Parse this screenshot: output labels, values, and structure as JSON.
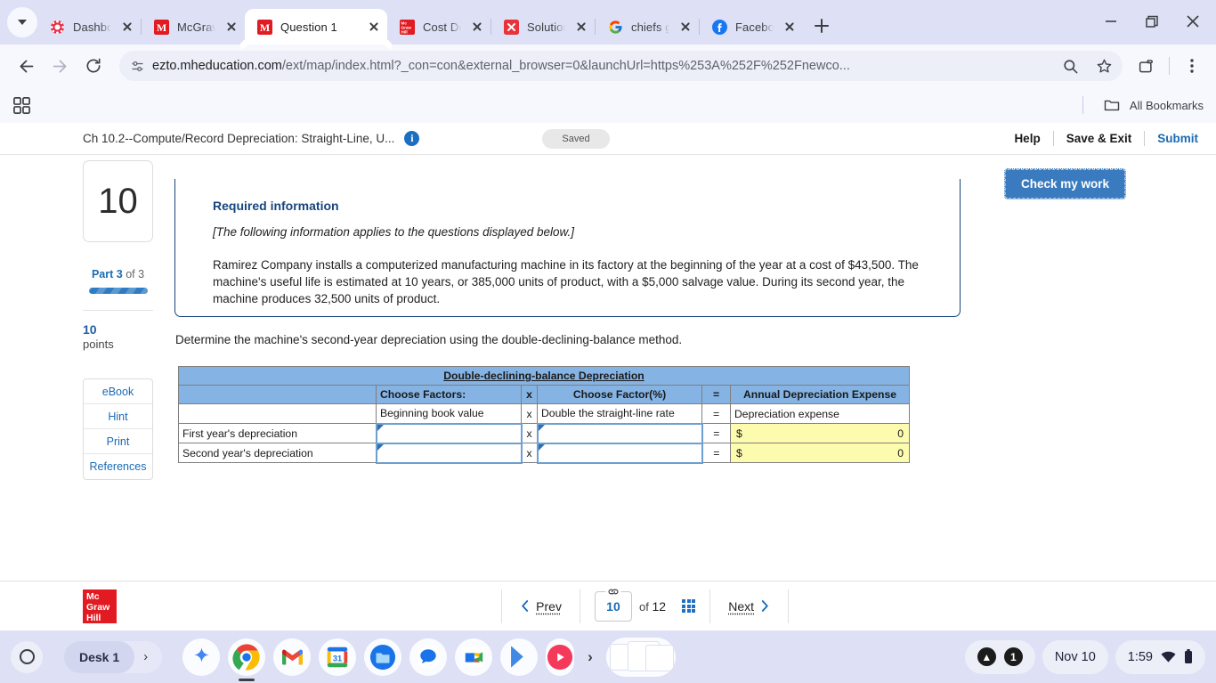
{
  "browser": {
    "tabs": [
      {
        "title": "Dashboard",
        "favicon": "canvas-icon",
        "active": false
      },
      {
        "title": "McGraw H",
        "favicon": "mcgraw-m-icon",
        "active": false
      },
      {
        "title": "Question 1",
        "favicon": "mcgraw-m-icon",
        "active": true
      },
      {
        "title": "Cost Dete",
        "favicon": "mcgraw-hill-icon",
        "active": false
      },
      {
        "title": "Solution -",
        "favicon": "chegg-icon",
        "active": false
      },
      {
        "title": "chiefs gam",
        "favicon": "google-icon",
        "active": false
      },
      {
        "title": "Facebook",
        "favicon": "facebook-icon",
        "active": false
      }
    ],
    "new_tab_label": "+",
    "url_host": "ezto.mheducation.com",
    "url_path": "/ext/map/index.html?_con=con&external_browser=0&launchUrl=https%253A%252F%252Fnewco...",
    "bookmarks": {
      "all_bookmarks_label": "All Bookmarks"
    }
  },
  "header": {
    "title": "Ch 10.2--Compute/Record Depreciation: Straight-Line, U...",
    "info_icon": "info-icon",
    "saved_label": "Saved",
    "help_label": "Help",
    "save_exit_label": "Save & Exit",
    "submit_label": "Submit",
    "check_my_work_label": "Check my work"
  },
  "rail": {
    "question_number": "10",
    "part_prefix": "Part",
    "part_current": "3",
    "part_of": "of 3",
    "points_value": "10",
    "points_label": "points",
    "buttons": [
      "eBook",
      "Hint",
      "Print",
      "References"
    ]
  },
  "required_info": {
    "heading": "Required information",
    "applies_note": "[The following information applies to the questions displayed below.]",
    "body": "Ramirez Company installs a computerized manufacturing machine in its factory at the beginning of the year at a cost of $43,500. The machine's useful life is estimated at 10 years, or 385,000 units of product, with a $5,000 salvage value. During its second year, the machine produces 32,500 units of product."
  },
  "prompt": "Determine the machine's second-year depreciation using the double-declining-balance method.",
  "table": {
    "title": "Double-declining-balance Depreciation",
    "headers": {
      "blank": "",
      "factors": "Choose Factors:",
      "times": "x",
      "percent": "Choose Factor(%)",
      "equals": "=",
      "expense": "Annual Depreciation Expense"
    },
    "legend_row": {
      "label": "",
      "factors": "Beginning book value",
      "times": "x",
      "percent": "Double the straight-line rate",
      "equals": "=",
      "expense": "Depreciation expense"
    },
    "rows": [
      {
        "label": "First year's depreciation",
        "factors_value": "",
        "times": "x",
        "percent_value": "",
        "equals": "=",
        "currency": "$",
        "amount": "0"
      },
      {
        "label": "Second year's depreciation",
        "factors_value": "",
        "times": "x",
        "percent_value": "",
        "equals": "=",
        "currency": "$",
        "amount": "0"
      }
    ],
    "colors": {
      "header_blue": "#85b3e3",
      "answer_yellow": "#fdfbae",
      "input_border": "#6d9fd1"
    }
  },
  "footer": {
    "logo_lines": [
      "Mc",
      "Graw",
      "Hill"
    ],
    "prev_label": "Prev",
    "page_value": "10",
    "of_label": "of",
    "total_pages": "12",
    "next_label": "Next",
    "grid_icon": "grid-view-icon"
  },
  "shelf": {
    "launcher_icon": "launcher-circle-icon",
    "desk_label": "Desk 1",
    "desk_arrow_icon": "chevron-right-icon",
    "apps": [
      "gemini-icon",
      "chrome-icon",
      "gmail-icon",
      "calendar-icon",
      "files-icon",
      "chat-icon",
      "meet-icon",
      "play-store-icon",
      "youtube-music-icon"
    ],
    "overflow_icon": "chevron-right-icon",
    "notification_count": "1",
    "date": "Nov 10",
    "time": "1:59",
    "wifi_icon": "wifi-icon",
    "battery_icon": "battery-icon"
  }
}
